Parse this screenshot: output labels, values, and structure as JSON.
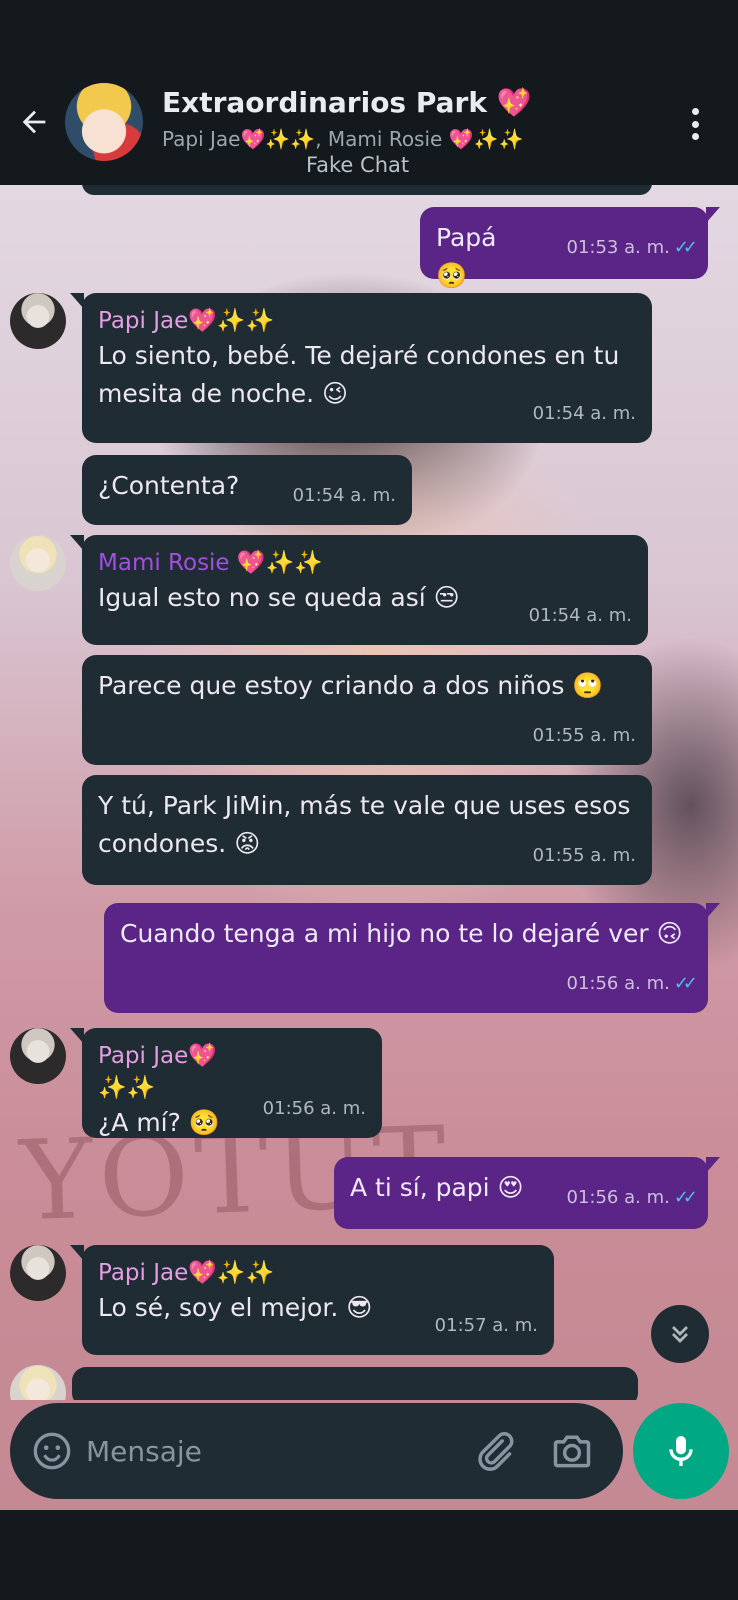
{
  "header": {
    "title": "Extraordinarios Park 💖",
    "members": "Papi Jae💖✨✨, Mami Rosie 💖✨✨",
    "overlay_caption": "Fake Chat"
  },
  "messages": [
    {
      "direction": "out",
      "text": "Papá 🥺",
      "time": "01:53 a. m.",
      "ticks": "✓✓"
    },
    {
      "direction": "in",
      "sender": "Papi Jae💖✨✨",
      "text": "Lo siento, bebé. Te dejaré condones en tu mesita de noche. 😉",
      "time": "01:54 a. m."
    },
    {
      "direction": "in",
      "text": "¿Contenta?",
      "time": "01:54 a. m."
    },
    {
      "direction": "in",
      "sender": "Mami Rosie 💖✨✨",
      "text": "Igual esto no se queda así 😒",
      "time": "01:54 a. m."
    },
    {
      "direction": "in",
      "text": "Parece que estoy criando a dos niños 🙄",
      "time": "01:55 a. m."
    },
    {
      "direction": "in",
      "text": "Y tú, Park JiMin, más te vale que uses esos condones. 😡",
      "time": "01:55 a. m."
    },
    {
      "direction": "out",
      "text": "Cuando tenga a mi hijo no te lo dejaré ver 🙃",
      "time": "01:56 a. m.",
      "ticks": "✓✓"
    },
    {
      "direction": "in",
      "sender": "Papi Jae💖✨✨",
      "text": "¿A mí? 🥺",
      "time": "01:56 a. m."
    },
    {
      "direction": "out",
      "text": "A ti sí, papi 😍",
      "time": "01:56 a. m.",
      "ticks": "✓✓"
    },
    {
      "direction": "in",
      "sender": "Papi Jae💖✨✨",
      "text": "Lo sé, soy el mejor. 😎",
      "time": "01:57 a. m."
    }
  ],
  "wallpaper_text": "YOTUT",
  "composer": {
    "placeholder": "Mensaje"
  },
  "icons": {
    "back": "arrow-left-icon",
    "menu": "more-vert-icon",
    "emoji": "emoji-icon",
    "attach": "paperclip-icon",
    "camera": "camera-icon",
    "mic": "mic-icon",
    "scroll": "chevron-double-down-icon"
  },
  "colors": {
    "header_bg": "#13191d",
    "incoming_bubble": "#1f2c33",
    "outgoing_bubble": "#5a2587",
    "read_ticks": "#53bdeb",
    "mic_button": "#00a884",
    "sender_jae": "#e59de3",
    "sender_rosie": "#a14fe0"
  }
}
